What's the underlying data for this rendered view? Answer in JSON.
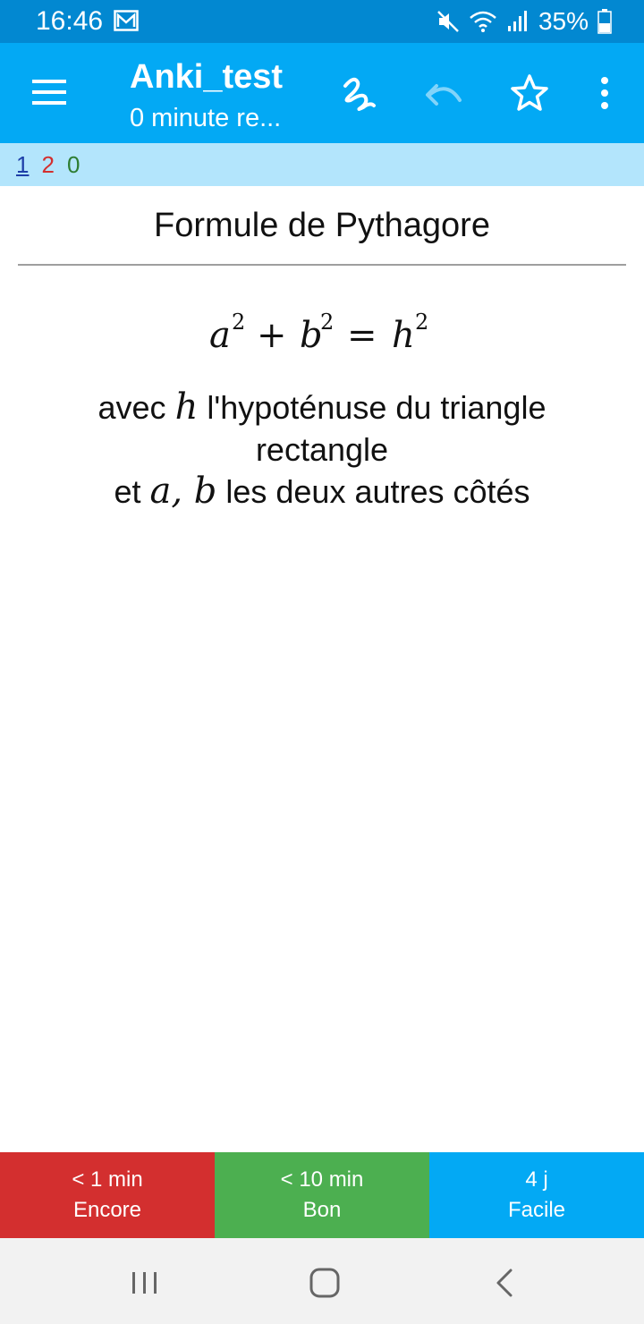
{
  "status_bar": {
    "time": "16:46",
    "battery": "35%",
    "icons": [
      "gmail-icon",
      "mute-icon",
      "wifi-icon",
      "signal-icon",
      "battery-icon"
    ]
  },
  "app_bar": {
    "title": "Anki_test",
    "subtitle": "0 minute re...",
    "icons": [
      "menu-icon",
      "whiteboard-icon",
      "undo-icon",
      "star-icon",
      "more-vert-icon"
    ]
  },
  "counts": {
    "new": "1",
    "learning": "2",
    "review": "0"
  },
  "card": {
    "question": "Formule de Pythagore",
    "formula": {
      "a": "a",
      "b": "b",
      "h": "h",
      "exp": "2",
      "plus": "+",
      "equals": "="
    },
    "answer": {
      "line1_pre": "avec ",
      "var_h": "h",
      "line1_post": " l'hypoténuse du triangle rectangle",
      "line2_pre": "et ",
      "var_ab": "a, b",
      "line2_post": " les deux autres côtés"
    }
  },
  "answer_buttons": [
    {
      "interval": "< 1 min",
      "label": "Encore"
    },
    {
      "interval": "< 10 min",
      "label": "Bon"
    },
    {
      "interval": "4 j",
      "label": "Facile"
    }
  ],
  "colors": {
    "status_bar": "#0288d1",
    "app_bar": "#03a9f4",
    "count_bar": "#b3e5fc",
    "again": "#d32f2f",
    "good": "#4caf50",
    "easy": "#03a9f4",
    "new_count": "#1e3fa8",
    "learning_count": "#d32f2f",
    "review_count": "#2e7d32"
  }
}
